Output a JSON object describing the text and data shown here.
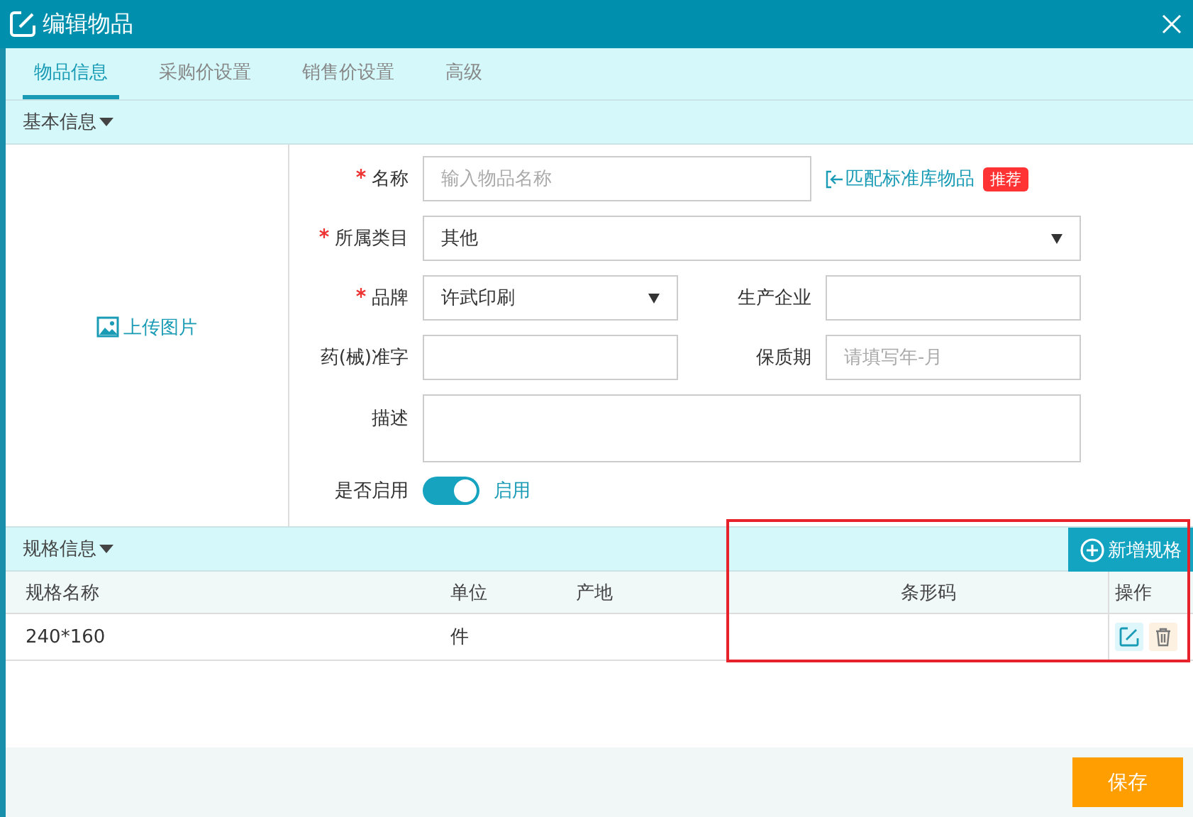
{
  "window": {
    "title": "编辑物品"
  },
  "tabs": [
    {
      "label": "物品信息",
      "selected": true
    },
    {
      "label": "采购价设置",
      "selected": false
    },
    {
      "label": "销售价设置",
      "selected": false
    },
    {
      "label": "高级",
      "selected": false
    }
  ],
  "basic_section": {
    "title": "基本信息",
    "expanded": true
  },
  "upload": {
    "label": "上传图片"
  },
  "form": {
    "name": {
      "label": "名称",
      "required": true,
      "placeholder": "输入物品名称"
    },
    "match_link": "匹配标准库物品",
    "match_badge": "推荐",
    "category": {
      "label": "所属类目",
      "required": true,
      "value": "其他"
    },
    "brand": {
      "label": "品牌",
      "required": true,
      "value": "许武印刷"
    },
    "manufacturer": {
      "label": "生产企业"
    },
    "approval": {
      "label": "药(械)准字"
    },
    "shelf_life": {
      "label": "保质期",
      "placeholder": "请填写年-月"
    },
    "description": {
      "label": "描述"
    },
    "enabled": {
      "label": "是否启用",
      "on": true,
      "text": "启用"
    }
  },
  "spec_section": {
    "title": "规格信息",
    "expanded": true,
    "add_button": "新增规格"
  },
  "table": {
    "columns": [
      "规格名称",
      "单位",
      "产地",
      "条形码",
      "操作"
    ],
    "rows": [
      {
        "name": "240*160",
        "unit": "件",
        "origin": "",
        "barcode": ""
      }
    ]
  },
  "footer": {
    "save_button": "保存"
  }
}
